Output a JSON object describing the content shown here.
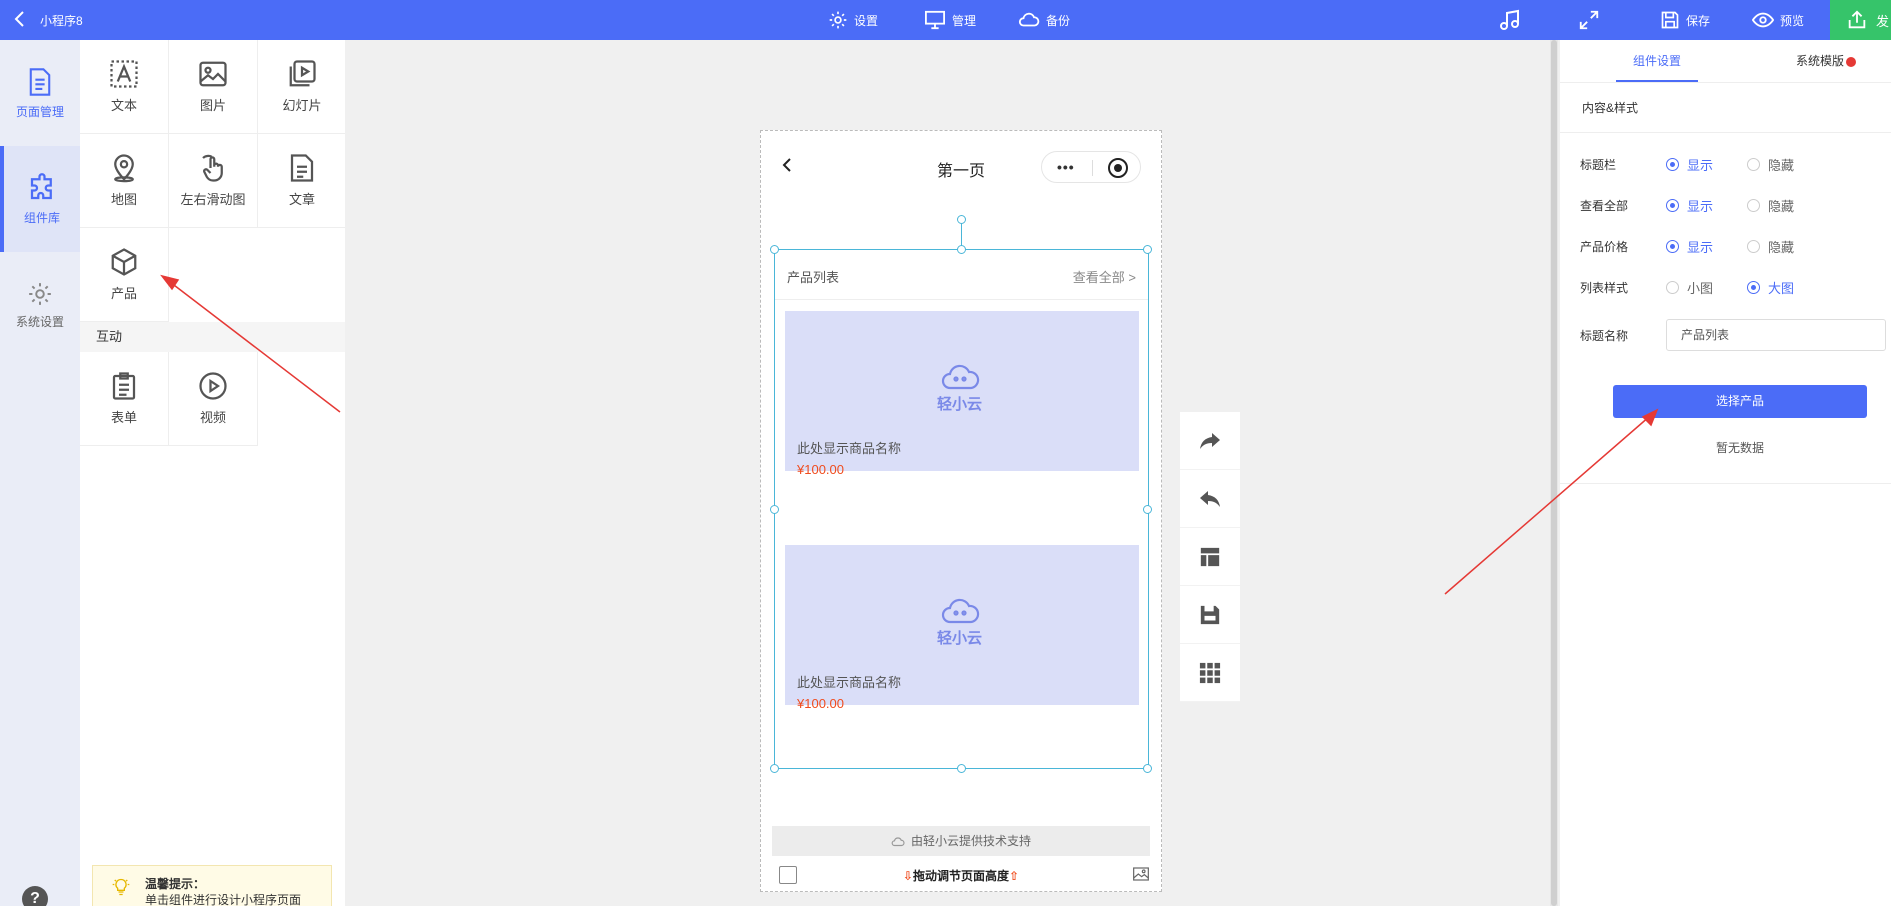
{
  "topbar": {
    "app_title": "小程序8",
    "settings": "设置",
    "manage": "管理",
    "backup": "备份",
    "save": "保存",
    "preview": "预览",
    "publish": "发"
  },
  "leftnav": {
    "items": [
      {
        "label": "页面管理",
        "icon": "page-icon"
      },
      {
        "label": "组件库",
        "icon": "puzzle-icon"
      },
      {
        "label": "系统设置",
        "icon": "gear-icon"
      }
    ]
  },
  "palette": {
    "components": [
      {
        "label": "文本",
        "icon": "text-icon"
      },
      {
        "label": "图片",
        "icon": "image-icon"
      },
      {
        "label": "幻灯片",
        "icon": "slideshow-icon"
      },
      {
        "label": "地图",
        "icon": "map-pin-icon"
      },
      {
        "label": "左右滑动图",
        "icon": "swipe-hand-icon"
      },
      {
        "label": "文章",
        "icon": "article-icon"
      },
      {
        "label": "产品",
        "icon": "box-icon"
      }
    ],
    "section_interactive": "互动",
    "interactive": [
      {
        "label": "表单",
        "icon": "clipboard-icon"
      },
      {
        "label": "视频",
        "icon": "play-icon"
      }
    ],
    "tip_title": "温馨提示：",
    "tip_text": "单击组件进行设计小程序页面"
  },
  "phone": {
    "page_title": "第一页",
    "capsule_dots": "•••",
    "list_title": "产品列表",
    "view_all": "查看全部 >",
    "brand": "轻小云",
    "products": [
      {
        "name": "此处显示商品名称",
        "price": "¥100.00"
      },
      {
        "name": "此处显示商品名称",
        "price": "¥100.00"
      }
    ],
    "powered_by": "由轻小云提供技术支持",
    "drag_hint": "拖动调节页面高度"
  },
  "right_panel": {
    "tab_component": "组件设置",
    "tab_system": "系统模版",
    "section_title": "内容&样式",
    "rows": [
      {
        "label": "标题栏",
        "opt1": "显示",
        "opt2": "隐藏",
        "selected": 1
      },
      {
        "label": "查看全部",
        "opt1": "显示",
        "opt2": "隐藏",
        "selected": 1
      },
      {
        "label": "产品价格",
        "opt1": "显示",
        "opt2": "隐藏",
        "selected": 1
      },
      {
        "label": "列表样式",
        "opt1": "小图",
        "opt2": "大图",
        "selected": 2
      }
    ],
    "title_name_label": "标题名称",
    "title_name_value": "产品列表",
    "select_button": "选择产品",
    "no_data": "暂无数据"
  },
  "colors": {
    "primary": "#4b6cf7",
    "publish": "#36c46a",
    "price": "#f04c1e",
    "selection": "#4ab6d8",
    "annotation": "#e53935"
  }
}
